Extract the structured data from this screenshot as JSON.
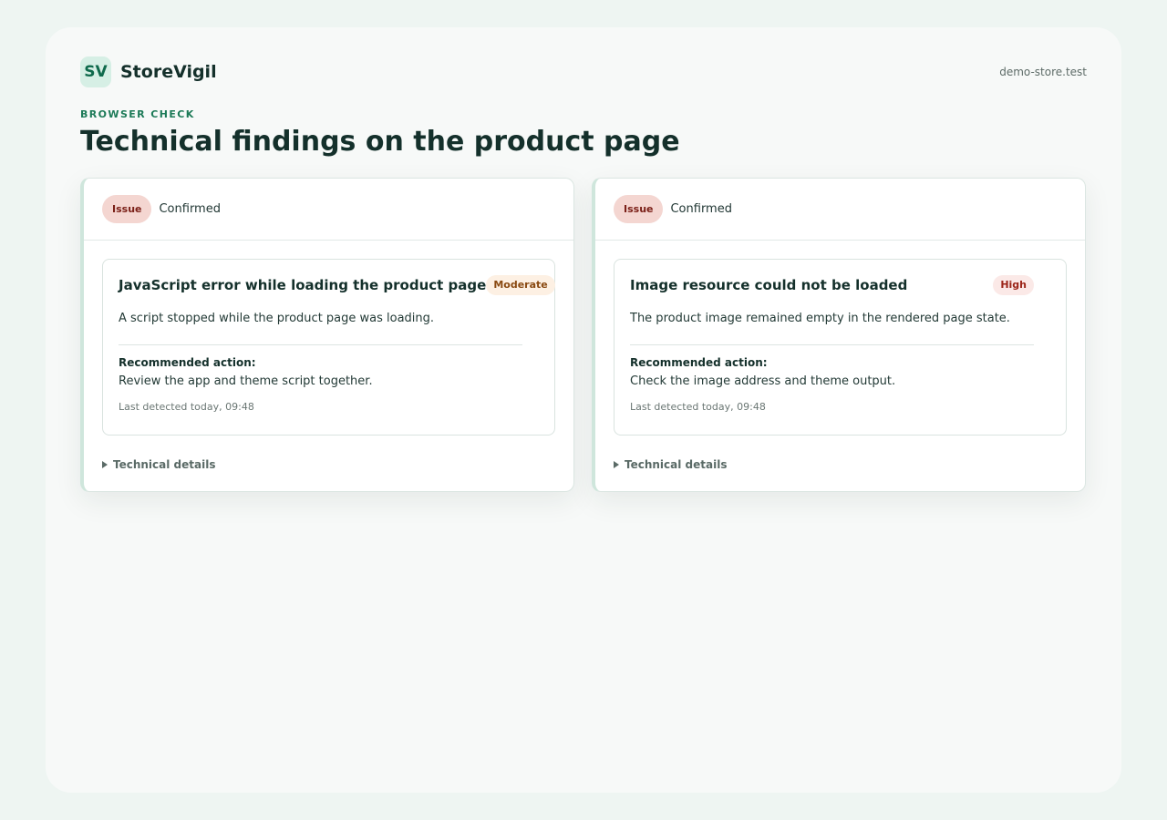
{
  "brand": {
    "logo_text": "SV",
    "name": "StoreVigil"
  },
  "store": {
    "url": "demo-store.test"
  },
  "page": {
    "eyebrow": "BROWSER CHECK",
    "title": "Technical findings on the product page"
  },
  "cards": [
    {
      "status_badge": "Issue",
      "status_text": "Confirmed",
      "finding": {
        "title": "JavaScript error while loading the product page",
        "severity": "Moderate",
        "description": "A script stopped while the product page was loading.",
        "recommended_label": "Recommended action:",
        "recommended_text": "Review the app and theme script together.",
        "last_detected": "Last detected today, 09:48"
      },
      "details_label": "Technical details"
    },
    {
      "status_badge": "Issue",
      "status_text": "Confirmed",
      "finding": {
        "title": "Image resource could not be loaded",
        "severity": "High",
        "description": "The product image remained empty in the rendered page state.",
        "recommended_label": "Recommended action:",
        "recommended_text": "Check the image address and theme output.",
        "last_detected": "Last detected today, 09:48"
      },
      "details_label": "Technical details"
    }
  ],
  "colors": {
    "accent": "#1c7a57",
    "issue_bg": "#f4d6d1",
    "severity_moderate": "#8a4a12",
    "severity_high": "#9b2418"
  }
}
